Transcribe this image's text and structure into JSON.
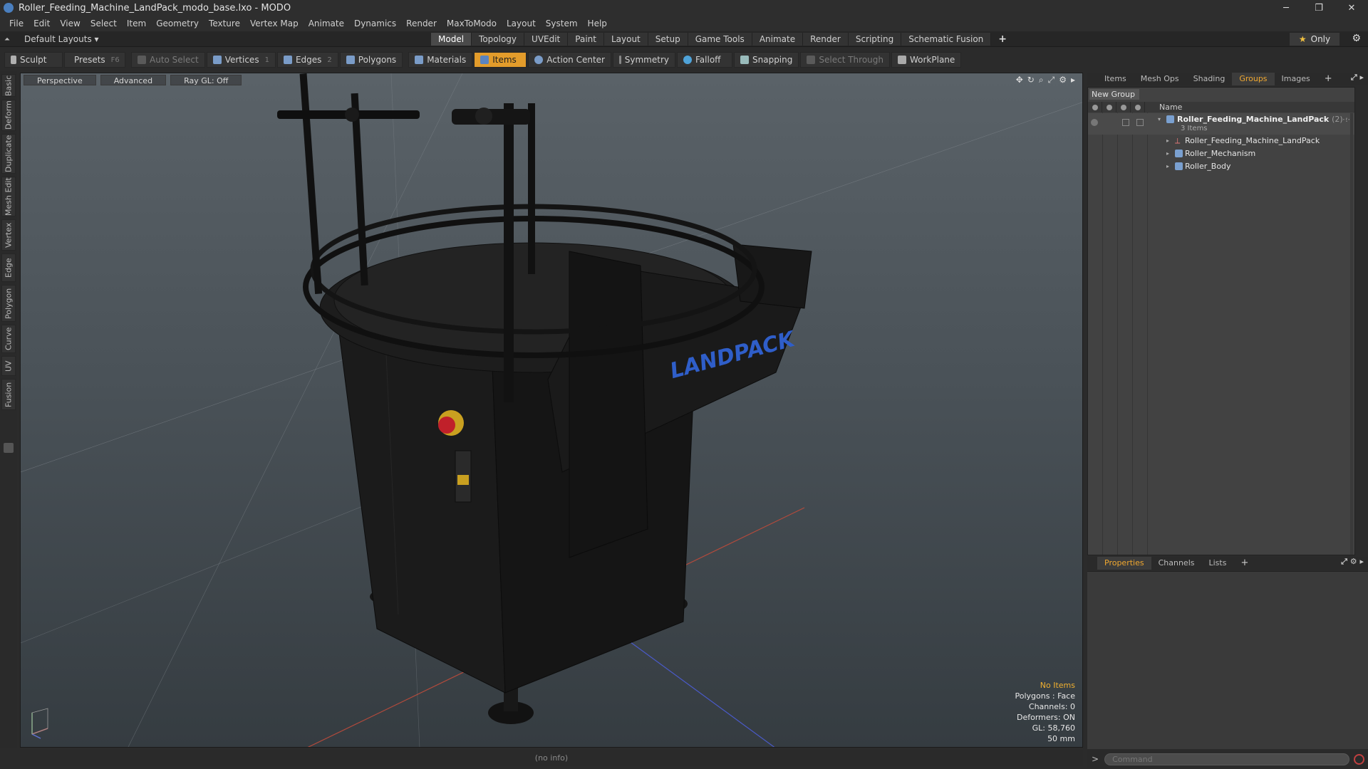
{
  "window": {
    "title": "Roller_Feeding_Machine_LandPack_modo_base.lxo - MODO",
    "minimize": "─",
    "maximize": "❐",
    "close": "✕"
  },
  "menu": [
    "File",
    "Edit",
    "View",
    "Select",
    "Item",
    "Geometry",
    "Texture",
    "Vertex Map",
    "Animate",
    "Dynamics",
    "Render",
    "MaxToModo",
    "Layout",
    "System",
    "Help"
  ],
  "layout_bar": {
    "layout_selector": "Default Layouts ▾",
    "tabs": [
      "Model",
      "Topology",
      "UVEdit",
      "Paint",
      "Layout",
      "Setup",
      "Game Tools",
      "Animate",
      "Render",
      "Scripting",
      "Schematic Fusion"
    ],
    "active_tab": "Model",
    "add_tab": "+",
    "only_star": "★",
    "only_label": "Only",
    "settings_glyph": "⚙"
  },
  "toolbar": {
    "sculpt": "Sculpt",
    "presets": "Presets",
    "presets_key": "F6",
    "auto_select": "Auto Select",
    "vertices": "Vertices",
    "vertices_count": "1",
    "edges": "Edges",
    "edges_count": "2",
    "polygons": "Polygons",
    "materials": "Materials",
    "items": "Items",
    "action_center": "Action Center",
    "symmetry": "Symmetry",
    "falloff": "Falloff",
    "snapping": "Snapping",
    "select_through": "Select Through",
    "workplane": "WorkPlane"
  },
  "left_tabs": [
    "Basic",
    "Deform",
    "Duplicate",
    "Mesh Edit",
    "Vertex",
    "Edge",
    "Polygon",
    "Curve",
    "UV",
    "Fusion"
  ],
  "viewport": {
    "view_mode": "Perspective",
    "shading": "Advanced",
    "raygl": "Ray GL: Off",
    "logo_text": "LANDPACK",
    "info": {
      "no_items": "No Items",
      "polygons": "Polygons : Face",
      "channels": "Channels: 0",
      "deformers": "Deformers: ON",
      "gl": "GL: 58,760",
      "grid": "50 mm"
    },
    "tool_glyphs": [
      "✥",
      "↻",
      "⌕",
      "⤢",
      "⚙",
      "▸"
    ]
  },
  "status_bar": "(no info)",
  "right_panel": {
    "top_tabs": [
      "Items",
      "Mesh Ops",
      "Shading",
      "Groups",
      "Images"
    ],
    "active_top_tab": "Groups",
    "add_tab": "+",
    "new_group": "New Group",
    "name_header": "Name",
    "tree": {
      "group_name": "Roller_Feeding_Machine_LandPack",
      "group_count": "(2) :",
      "group_sub": "3 Items",
      "children": [
        "Roller_Feeding_Machine_LandPack",
        "Roller_Mechanism",
        "Roller_Body"
      ]
    },
    "bottom_tabs": [
      "Properties",
      "Channels",
      "Lists"
    ],
    "active_bottom_tab": "Properties",
    "command_prompt": ">",
    "command_placeholder": "Command"
  },
  "colors": {
    "accent": "#e39c2b",
    "active_tab_text": "#f0a830",
    "viewport_top": "#5a6268",
    "viewport_bottom": "#353c41",
    "logo_blue": "#2f5ec9"
  }
}
